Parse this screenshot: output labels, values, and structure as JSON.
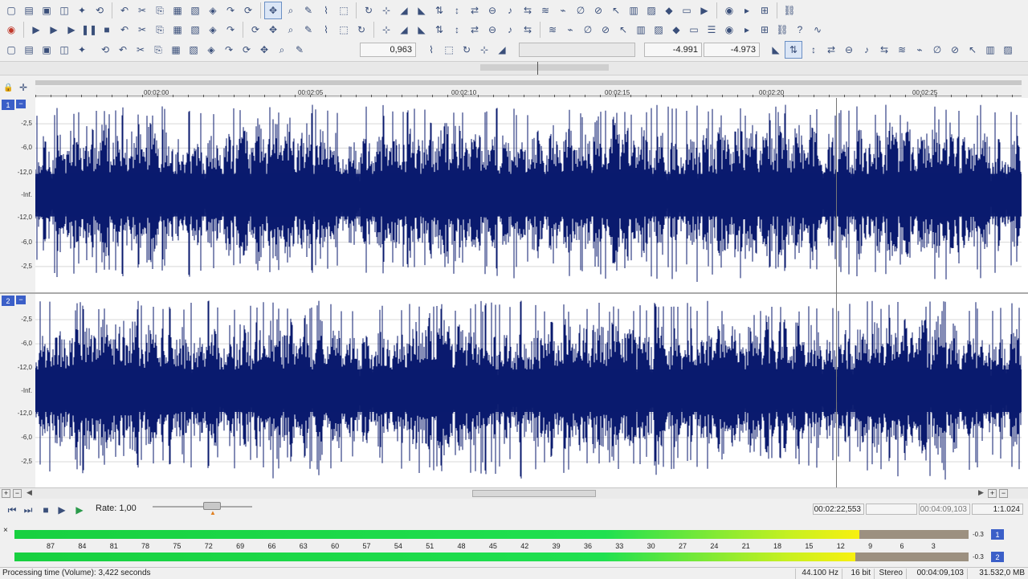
{
  "toolbar": {
    "zoom_value": "0,963",
    "level_left": "-4.991",
    "level_right": "-4.973",
    "row1_icons": [
      "new-file-icon",
      "open-folder-icon",
      "save-icon",
      "save-as-icon",
      "save-all-icon",
      "render-icon",
      "undo-icon",
      "cut-icon",
      "copy-icon",
      "paste-icon",
      "paste-insert-icon",
      "mix-icon",
      "redo-icon",
      "repeat-icon",
      "edit-tool-icon",
      "magnify-tool-icon",
      "pencil-tool-icon",
      "envelope-tool-icon",
      "event-tool-icon",
      "loop-icon",
      "snap-icon",
      "fade-in-icon",
      "fade-out-icon",
      "normalize-icon",
      "invert-icon",
      "reverse-icon",
      "dc-offset-icon",
      "volume-icon",
      "pan-icon",
      "eq-icon",
      "resample-icon",
      "silence-icon",
      "mute-icon",
      "cursor-icon",
      "spectrum-icon",
      "stats-icon",
      "marker-icon",
      "region-icon",
      "playlist-icon",
      "cd-icon",
      "explorer-icon",
      "plugin-icon",
      "chain-icon",
      "help-icon",
      "sine-icon"
    ],
    "row2_icons": [
      "record-icon",
      "loop-play-icon",
      "play-all-icon",
      "play-icon",
      "pause-icon",
      "stop-icon",
      "go-start-icon",
      "rewind-icon",
      "fast-forward-icon",
      "go-end-icon",
      "last-icon",
      "mark-in-icon",
      "mark-out-icon",
      "split-icon",
      "trim-icon",
      "crossfade-icon",
      "ripple-icon",
      "snap-grid-icon",
      "snap-marker-icon",
      "auto-scroll-icon",
      "preview-icon",
      "lock-icon",
      "grid-icon",
      "event-icon",
      "envelope-icon",
      "fx-icon",
      "plugins-icon",
      "nav-icon",
      "noise-icon",
      "click-icon",
      "clip-icon",
      "vinyl-icon",
      "spectral-icon",
      "analyze-icon",
      "bandpass-icon",
      "lowpass-icon",
      "highpass-icon",
      "notch-icon",
      "shelf-icon",
      "compressor-icon",
      "gate-icon",
      "limiter-icon",
      "reverb-icon",
      "delay-icon",
      "chorus-icon",
      "flanger-icon",
      "pitch-icon",
      "stretch-icon",
      "vibrato-icon",
      "distortion-icon",
      "settings-icon"
    ],
    "row3_icons": [
      "zoom-in-icon",
      "zoom-out-icon",
      "zoom-selection-icon",
      "zoom-normal-icon",
      "zoom-full-icon",
      "zoom-time-icon",
      "pan-left-icon",
      "pan-right-icon",
      "track-height-icon",
      "cursor-start-icon",
      "meters-icon",
      "peak-icon",
      "rms-icon",
      "spectrum-view-icon",
      "envelope-view-icon",
      "snap-toggle-icon",
      "follow-icon",
      "grid-lines-icon",
      "marker-add-icon",
      "region-add-icon",
      "cd-track-icon",
      "scrub-icon",
      "scrub-speed-icon",
      "clock-icon",
      "timer-icon",
      "sync-icon",
      "crossfade-view-icon",
      "play-region-icon",
      "loop-region-icon",
      "record-arm-icon",
      "monitor-icon",
      "metronome-icon",
      "input-icon",
      "output-icon",
      "mixer-icon",
      "channel-icon",
      "bus-icon",
      "fx-chain-icon",
      "send-icon",
      "return-icon",
      "solo-icon",
      "mute-track-icon",
      "phase-icon",
      "invert-view-icon",
      "options-icon",
      "fraction-icon"
    ]
  },
  "ruler": {
    "ticks": [
      "00:02:00",
      "00:02:05",
      "00:02:10",
      "00:02:15",
      "00:02:20",
      "00:02:25"
    ]
  },
  "channels": [
    {
      "number": "1",
      "collapse": "−",
      "db_labels": [
        "-2,5",
        "-6,0",
        "-12,0",
        "-Inf.",
        "-12,0",
        "-6,0",
        "-2,5"
      ]
    },
    {
      "number": "2",
      "collapse": "−",
      "db_labels": [
        "-2,5",
        "-6,0",
        "-12,0",
        "-Inf.",
        "-12,0",
        "-6,0",
        "-2,5"
      ]
    }
  ],
  "transport": {
    "rate_label": "Rate: 1,00",
    "cursor_position": "00:02:22,553",
    "selection_length": "",
    "file_length": "00:04:09,103",
    "zoom_ratio": "1:1.024"
  },
  "meters": {
    "scale": [
      "87",
      "84",
      "81",
      "78",
      "75",
      "72",
      "69",
      "66",
      "63",
      "60",
      "57",
      "54",
      "51",
      "48",
      "45",
      "42",
      "39",
      "36",
      "33",
      "30",
      "27",
      "24",
      "21",
      "18",
      "15",
      "12",
      "9",
      "6",
      "3"
    ],
    "peak_left": "-0.3",
    "peak_right": "-0.3",
    "level_left_fraction": 0.922,
    "level_right_fraction": 0.918,
    "ch1_label": "1",
    "ch2_label": "2",
    "close_label": "×"
  },
  "status": {
    "processing": "Processing time (Volume): 3,422 seconds",
    "sample_rate": "44.100 Hz",
    "bit_depth": "16 bit",
    "channels": "Stereo",
    "length": "00:04:09,103",
    "disk": "31.532,0 MB"
  },
  "colors": {
    "waveform": "#0a1a6e",
    "channel_badge": "#3b5fc8"
  }
}
